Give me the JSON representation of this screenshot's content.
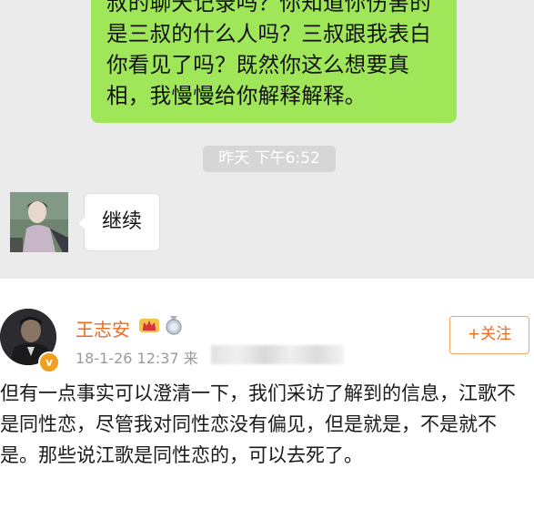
{
  "chat": {
    "outgoing_message": "叔的聊天记录吗？你知道你伤害的是三叔的什么人吗？三叔跟我表白你看见了吗？既然你这么想要真相，我慢慢给你解释解释。",
    "timestamp": "昨天 下午6:52",
    "incoming_message": "继续"
  },
  "post": {
    "username": "王志安",
    "verified_badge": "v",
    "date": "18-1-26 12:37",
    "source_prefix": "来",
    "follow_label": "+关注",
    "body": "但有一点事实可以澄清一下，我们采访了解到的信息，江歌不是同性恋，尽管我对同性恋没有偏见，但是就是，不是就不是。那些说江歌是同性恋的，可以去死了。"
  },
  "colors": {
    "chat_background": "#ebebeb",
    "outgoing_bubble": "#9fe658",
    "username": "#f06a1c",
    "follow_border": "#f6a55e"
  },
  "icons": [
    "crown-icon",
    "medal-icon",
    "verified-badge-icon"
  ]
}
